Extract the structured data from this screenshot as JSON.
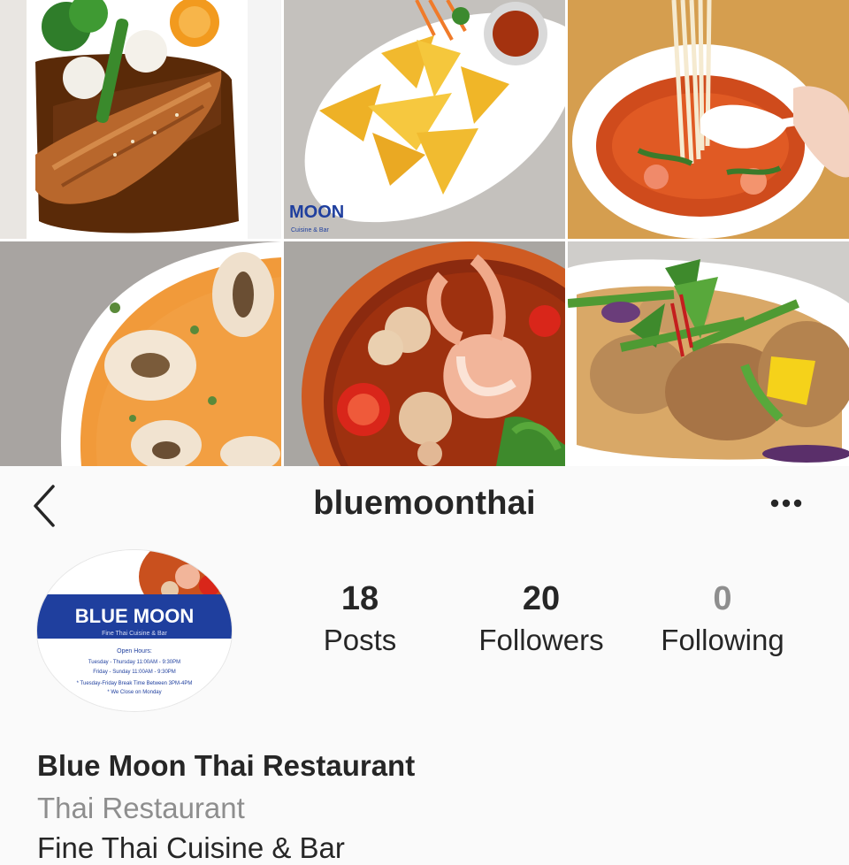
{
  "header": {
    "username": "bluemoonthai",
    "back_icon": "chevron-left-icon",
    "more_icon": "ellipsis-icon"
  },
  "grid": {
    "posts": [
      {
        "subject": "salmon-teriyaki-photo"
      },
      {
        "subject": "crab-rangoon-photo",
        "watermark": "MOON",
        "watermark_sub": "Cuisine & Bar"
      },
      {
        "subject": "noodle-soup-photo"
      },
      {
        "subject": "tom-kha-soup-photo"
      },
      {
        "subject": "tom-yum-shrimp-photo"
      },
      {
        "subject": "curry-duck-photo"
      }
    ]
  },
  "profile": {
    "avatar": {
      "logo_text": "BLUE MOON",
      "logo_sub": "Fine Thai Cuisine & Bar",
      "hours_title": "Open Hours:",
      "hours": [
        "Tuesday - Thursday 11:00AM - 9:30PM",
        "Friday - Sunday 11:00AM - 9:30PM"
      ],
      "notes": [
        "* Tuesday-Friday Break Time Between 3PM-4PM",
        "* We Close on Monday"
      ]
    },
    "stats": {
      "posts": {
        "count": "18",
        "label": "Posts"
      },
      "followers": {
        "count": "20",
        "label": "Followers"
      },
      "following": {
        "count": "0",
        "label": "Following"
      }
    },
    "name": "Blue Moon Thai Restaurant",
    "category": "Thai Restaurant",
    "bio": "Fine Thai Cuisine & Bar"
  },
  "colors": {
    "background": "#fafafa",
    "text": "#262626",
    "muted": "#8e8e8e",
    "brand_blue": "#1f3f9e"
  }
}
